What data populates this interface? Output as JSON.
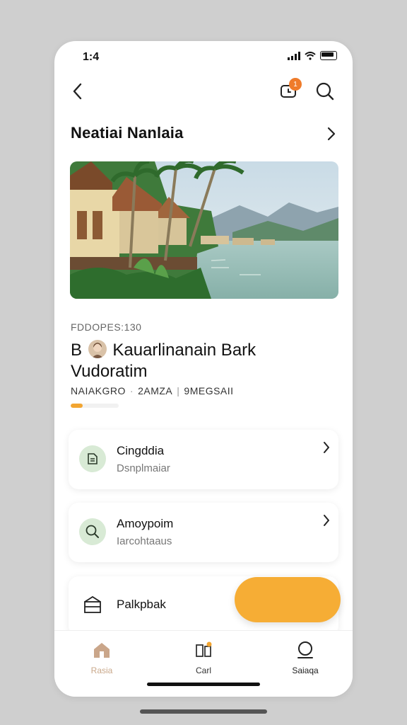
{
  "status_bar": {
    "time": "1:4"
  },
  "header": {
    "notification_count": "1"
  },
  "section": {
    "title": "Neatiai Nanlaia"
  },
  "listing": {
    "meta": "FDDOPES:130",
    "title_prefix": "B",
    "title_rest": "Kauarlinanain Bark Vudoratim",
    "tags": [
      "NAIAKGRO",
      "2AMZA",
      "9MEGSAII"
    ],
    "progress": 0.25
  },
  "cards": [
    {
      "title": "Cingddia",
      "subtitle": "Dsnplmaiar",
      "icon": "receipt-icon"
    },
    {
      "title": "Amoypoim",
      "subtitle": "Iarcohtaaus",
      "icon": "search-icon"
    },
    {
      "title": "Palkpbak",
      "icon": "box-icon"
    }
  ],
  "tabs": [
    {
      "label": "Rasia",
      "icon": "home-icon",
      "active": true
    },
    {
      "label": "Carl",
      "icon": "cart-icon",
      "active": false
    },
    {
      "label": "Saiaqa",
      "icon": "profile-icon",
      "active": false
    }
  ],
  "colors": {
    "accent": "#f6ad35",
    "badge": "#ef7b2a",
    "icon_bg": "#d8ead5",
    "active_tab": "#c9a88a"
  }
}
